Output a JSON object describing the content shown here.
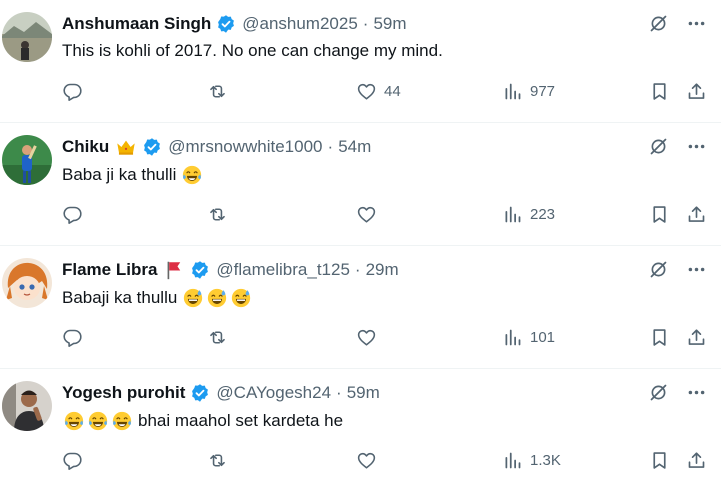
{
  "colors": {
    "text": "#0f1419",
    "secondary": "#536471",
    "verified": "#1d9bf0",
    "divider": "#eff3f4"
  },
  "tweets": [
    {
      "name": "Anshumaan Singh",
      "handle": "@anshum2025",
      "dot": "·",
      "time": "59m",
      "text": "This is kohli of 2017. No one can change my mind.",
      "text_emojis": [],
      "name_badge": "",
      "replies": "",
      "retweets": "",
      "likes": "44",
      "views": "977"
    },
    {
      "name": "Chiku",
      "handle": "@mrsnowwhite1000",
      "dot": "·",
      "time": "54m",
      "text": "Baba ji ka thulli",
      "text_emojis": [
        "face-with-tears-of-joy"
      ],
      "name_badge": "crown-icon",
      "replies": "",
      "retweets": "",
      "likes": "",
      "views": "223"
    },
    {
      "name": "Flame Libra",
      "handle": "@flamelibra_t125",
      "dot": "·",
      "time": "29m",
      "text": "Babaji ka thullu",
      "text_emojis": [
        "grinning-sweat",
        "grinning-sweat",
        "grinning-sweat"
      ],
      "name_badge": "red-flag-icon",
      "replies": "",
      "retweets": "",
      "likes": "",
      "views": "101"
    },
    {
      "name": "Yogesh purohit",
      "handle": "@CAYogesh24",
      "dot": "·",
      "time": "59m",
      "text": "bhai maahol set kardeta he",
      "text_emojis_before": [
        "face-with-tears-of-joy",
        "face-with-tears-of-joy",
        "face-with-tears-of-joy"
      ],
      "name_badge": "",
      "replies": "",
      "retweets": "",
      "likes": "",
      "views": "1.3K"
    }
  ]
}
